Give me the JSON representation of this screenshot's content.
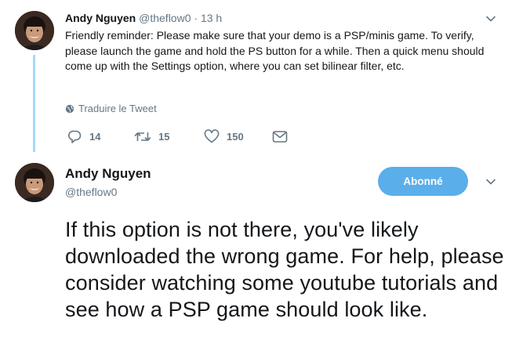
{
  "tweet1": {
    "author_name": "Andy Nguyen",
    "handle": "@theflow0",
    "separator": "·",
    "time": "13 h",
    "text": "Friendly reminder: Please make sure that your demo is a PSP/minis game. To verify, please launch the game and hold the PS button for a while. Then a quick menu should come up with the Settings option, where you can set bilinear filter, etc.",
    "translate_label": "Traduire le Tweet",
    "actions": {
      "reply_count": "14",
      "retweet_count": "15",
      "like_count": "150"
    }
  },
  "tweet2": {
    "author_name": "Andy Nguyen",
    "handle": "@theflow0",
    "follow_label": "Abonné",
    "text": "If this option is not there, you've likely downloaded the wrong game. For help, please consider watching some youtube tutorials and see how a PSP game should look like."
  },
  "colors": {
    "accent": "#5aaeea",
    "thread_line": "#a4d9f5",
    "secondary_text": "#657786",
    "primary_text": "#14171a"
  },
  "icons": [
    "reply-icon",
    "retweet-icon",
    "like-icon",
    "message-icon",
    "globe-icon",
    "chevron-down-icon"
  ]
}
